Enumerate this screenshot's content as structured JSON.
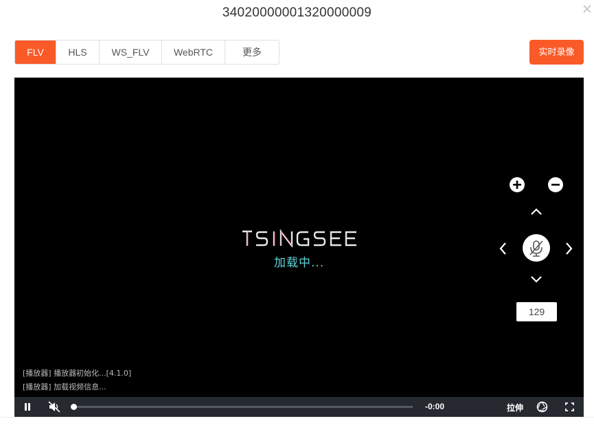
{
  "dialog": {
    "title": "34020000001320000009"
  },
  "tabs": [
    {
      "label": "FLV",
      "active": true
    },
    {
      "label": "HLS",
      "active": false
    },
    {
      "label": "WS_FLV",
      "active": false
    },
    {
      "label": "WebRTC",
      "active": false
    },
    {
      "label": "更多",
      "active": false
    }
  ],
  "record_button": {
    "label": "实时录像"
  },
  "player": {
    "brand_logo": "TSINGSEE",
    "loading_text": "加载中...",
    "log_lines": [
      "[播放器] 播放器初始化...[4.1.0]",
      "[播放器] 加载视频信息..."
    ],
    "ptz": {
      "zoom_value": "129"
    },
    "controls": {
      "time": "-0:00",
      "stretch_label": "拉伸",
      "progress_fraction": 0.0
    }
  },
  "colors": {
    "accent": "#fa5a28",
    "loading": "#5fd3d8",
    "control_bar": "#262a30"
  }
}
